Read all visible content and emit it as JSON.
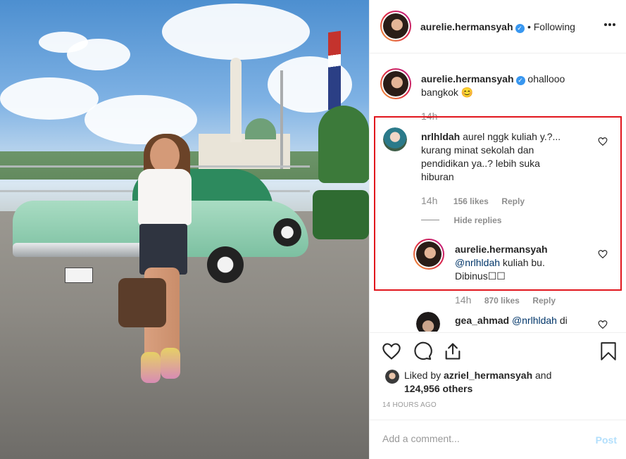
{
  "header": {
    "username": "aurelie.hermansyah",
    "follow_status": "• Following",
    "more_icon": "more-icon"
  },
  "caption": {
    "username": "aurelie.hermansyah",
    "text_line1": "ohallooo",
    "text_line2": "bangkok 😊",
    "time": "14h"
  },
  "comments": [
    {
      "username": "nrlhldah",
      "lines": [
        "aurel nggk kuliah y.?...",
        "kurang minat sekolah dan",
        "pendidikan ya..? lebih suka",
        "hiburan"
      ],
      "time": "14h",
      "likes": "156 likes",
      "reply": "Reply",
      "hide_replies": "Hide replies"
    },
    {
      "username": "aurelie.hermansyah",
      "mention": "@nrlhldah",
      "line1_rest": " kuliah bu.",
      "line2": "Dibinus☐☐",
      "time": "14h",
      "likes": "870 likes",
      "reply": "Reply"
    },
    {
      "username": "gea_ahmad",
      "mention": "@nrlhldah",
      "text": "di"
    }
  ],
  "likes": {
    "prefix": "Liked by ",
    "user": "azriel_hermansyah",
    "suffix": " and",
    "others": "124,956 others"
  },
  "timestamp": "14 HOURS AGO",
  "add_comment": {
    "placeholder": "Add a comment...",
    "post_label": "Post"
  },
  "colors": {
    "highlight": "#e1161d",
    "verified": "#3897f0",
    "post_disabled": "#b2dffc"
  }
}
